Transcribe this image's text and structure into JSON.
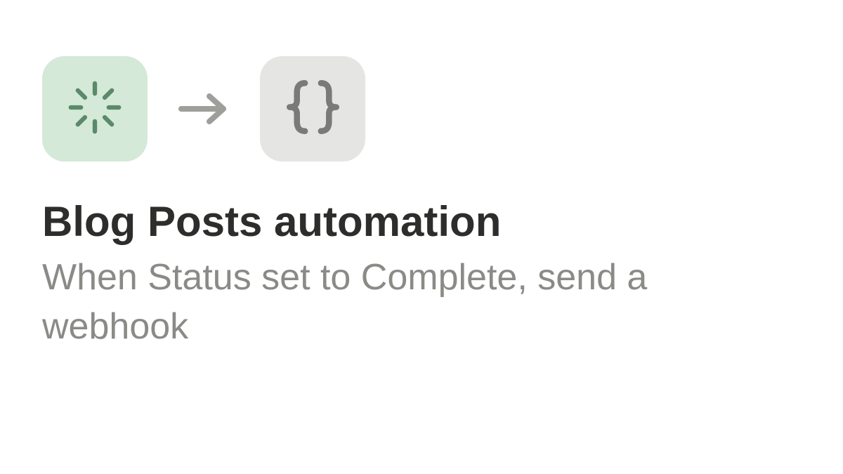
{
  "automation": {
    "title": "Blog Posts automation",
    "description": "When Status set to Complete, send a webhook",
    "trigger_icon": "status-spinner",
    "action_icon": "webhook-braces",
    "trigger_color": "#d4e9d7",
    "action_color": "#e5e5e3",
    "trigger_icon_color": "#5a8a6a",
    "action_icon_color": "#7a7a76"
  }
}
